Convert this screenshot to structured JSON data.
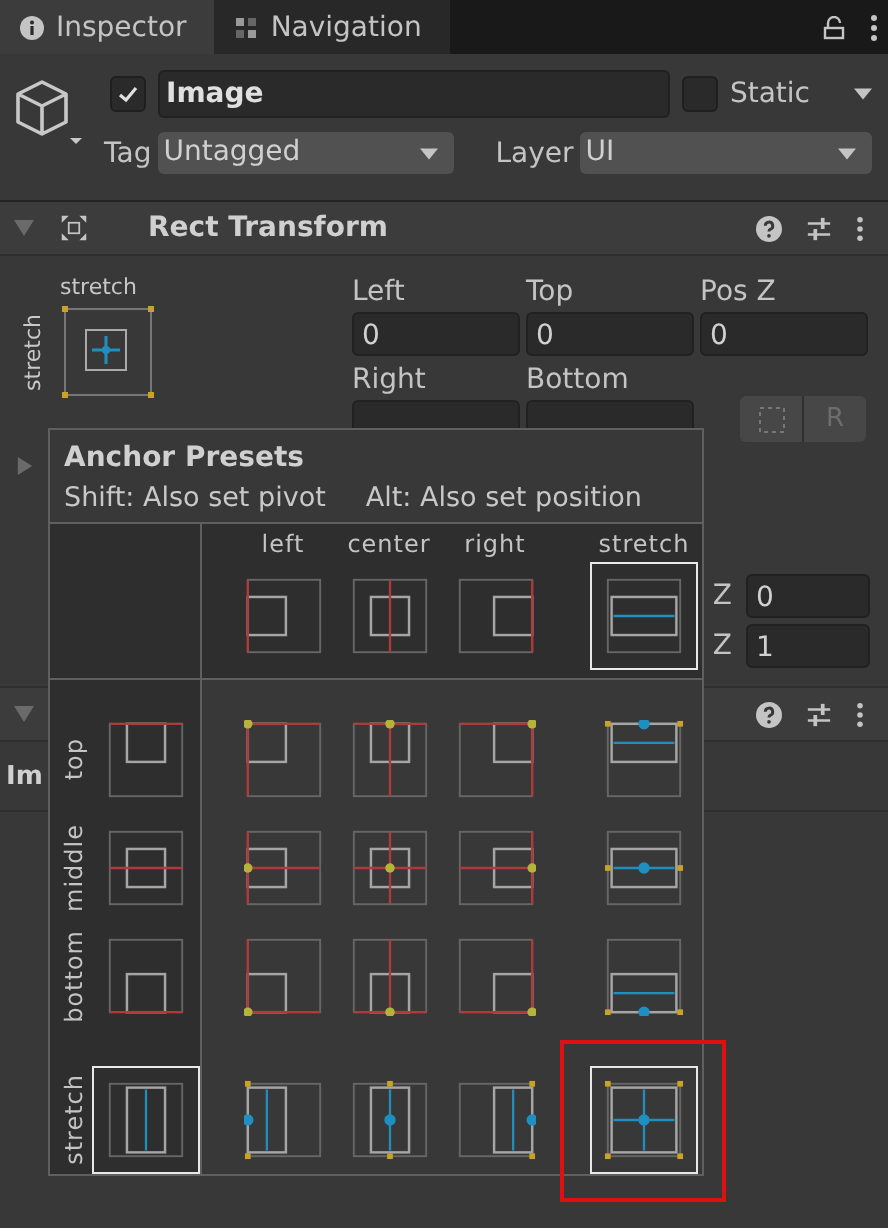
{
  "tabs": [
    {
      "label": "Inspector",
      "selected": true
    },
    {
      "label": "Navigation",
      "selected": false
    }
  ],
  "object": {
    "active": true,
    "name": "Image",
    "static": false,
    "static_label": "Static",
    "tag_label": "Tag",
    "tag": "Untagged",
    "layer_label": "Layer",
    "layer": "UI"
  },
  "rect_transform": {
    "title": "Rect Transform",
    "expanded": true,
    "anchor_h": "stretch",
    "anchor_v": "stretch",
    "fields": [
      {
        "label": "Left",
        "value": "0"
      },
      {
        "label": "Top",
        "value": "0"
      },
      {
        "label": "Pos Z",
        "value": "0"
      },
      {
        "label": "Right"
      },
      {
        "label": "Bottom"
      }
    ],
    "raw_button": "R",
    "scale_fields": [
      {
        "label": "Z",
        "value": "0"
      },
      {
        "label": "Z",
        "value": "1"
      }
    ]
  },
  "next_component": {
    "expanded": true,
    "name": "Im"
  },
  "anchor_presets": {
    "title": "Anchor Presets",
    "hints": [
      "Shift: Also set pivot",
      "Alt: Also set position"
    ],
    "columns": [
      {
        "label": "left",
        "selected": false
      },
      {
        "label": "center",
        "selected": false
      },
      {
        "label": "right",
        "selected": false
      },
      {
        "label": "stretch",
        "selected": true
      }
    ],
    "rows": [
      {
        "label": "top",
        "selected": false,
        "cells": [
          {
            "selected": false,
            "highlighted": false
          },
          {
            "selected": false,
            "highlighted": false
          },
          {
            "selected": false,
            "highlighted": false
          },
          {
            "selected": false,
            "highlighted": false
          }
        ]
      },
      {
        "label": "middle",
        "selected": false,
        "cells": [
          {
            "selected": false,
            "highlighted": false
          },
          {
            "selected": false,
            "highlighted": false
          },
          {
            "selected": false,
            "highlighted": false
          },
          {
            "selected": false,
            "highlighted": false
          }
        ]
      },
      {
        "label": "bottom",
        "selected": false,
        "cells": [
          {
            "selected": false,
            "highlighted": false
          },
          {
            "selected": false,
            "highlighted": false
          },
          {
            "selected": false,
            "highlighted": false
          },
          {
            "selected": false,
            "highlighted": false
          }
        ]
      },
      {
        "label": "stretch",
        "selected": true,
        "cells": [
          {
            "selected": false,
            "highlighted": false
          },
          {
            "selected": false,
            "highlighted": false
          },
          {
            "selected": false,
            "highlighted": false
          },
          {
            "selected": true,
            "highlighted": true
          }
        ]
      }
    ]
  }
}
